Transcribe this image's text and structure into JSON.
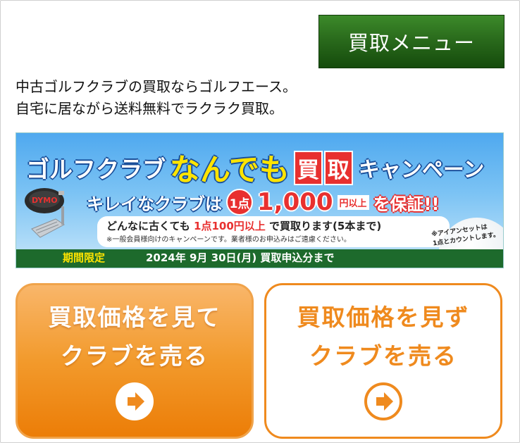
{
  "menu_button": {
    "label": "買取メニュー"
  },
  "intro": {
    "line1": "中古ゴルフクラブの買取ならゴルフエース。",
    "line2": "自宅に居ながら送料無料でラクラク買取。"
  },
  "banner": {
    "title_left": "ゴルフクラブ",
    "title_mid": "なんでも",
    "title_kanji1": "買",
    "title_kanji2": "取",
    "title_right": "キャンペーン",
    "sub_left": "キレイなクラブは",
    "sub_circle": "1点",
    "sub_amount": "1,000",
    "sub_unit": "円以上",
    "sub_right": "を保証!!",
    "line1_a": "どんなに古くても",
    "line1_red": "1点100円以上",
    "line1_b": "で買取ります(5本まで)",
    "line2": "※一般会員様向けのキャンペーンです。業者様のお申込みはご遠慮ください。",
    "limited": "期間限定",
    "period": "2024年 9月 30日(月) 買取申込分まで",
    "note_line1": "※アイアンセットは",
    "note_line2": "1点とカウントします。",
    "club_brand": "DYMO"
  },
  "cards": {
    "left": {
      "line1": "買取価格を見て",
      "line2": "クラブを売る"
    },
    "right": {
      "line1": "買取価格を見ず",
      "line2": "クラブを売る"
    }
  },
  "colors": {
    "menu_green": "#2a6b1c",
    "orange": "#ef8a1e",
    "banner_red": "#e8302f",
    "banner_yellow": "#ffe400"
  }
}
